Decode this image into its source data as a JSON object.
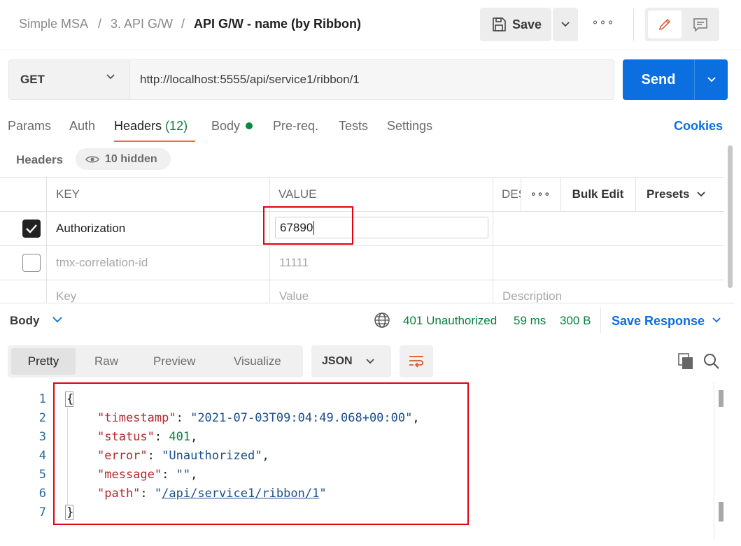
{
  "breadcrumb": {
    "collection": "Simple MSA",
    "folder": "3. API G/W",
    "request": "API G/W - name (by Ribbon)",
    "separator": "/"
  },
  "toolbar": {
    "save_label": "Save",
    "more": "∘∘∘"
  },
  "request": {
    "method": "GET",
    "url": "http://localhost:5555/api/service1/ribbon/1",
    "send_label": "Send"
  },
  "tabs": [
    {
      "label": "Params"
    },
    {
      "label": "Auth"
    },
    {
      "label": "Headers",
      "count": "(12)"
    },
    {
      "label": "Body"
    },
    {
      "label": "Pre-req."
    },
    {
      "label": "Tests"
    },
    {
      "label": "Settings"
    }
  ],
  "cookies_label": "Cookies",
  "headers_section": {
    "title": "Headers",
    "hidden_label": "10 hidden"
  },
  "headers_table": {
    "columns": {
      "key": "KEY",
      "value": "VALUE",
      "description": "DES"
    },
    "more": "∘∘∘",
    "bulk_edit": "Bulk Edit",
    "presets": "Presets",
    "rows": [
      {
        "enabled": true,
        "key": "Authorization",
        "value": "67890"
      },
      {
        "enabled": false,
        "key": "tmx-correlation-id",
        "value": "11111"
      }
    ],
    "placeholder": {
      "key": "Key",
      "value": "Value",
      "description": "Description"
    }
  },
  "response": {
    "body_label": "Body",
    "status": "401 Unauthorized",
    "time": "59 ms",
    "size": "300 B",
    "save_response": "Save Response",
    "view_tabs": [
      "Pretty",
      "Raw",
      "Preview",
      "Visualize"
    ],
    "format": "JSON",
    "line_numbers": [
      "1",
      "2",
      "3",
      "4",
      "5",
      "6",
      "7"
    ],
    "json": {
      "timestamp_key": "\"timestamp\"",
      "timestamp_val": "\"2021-07-03T09:04:49.068+00:00\"",
      "status_key": "\"status\"",
      "status_val": "401",
      "error_key": "\"error\"",
      "error_val": "\"Unauthorized\"",
      "message_key": "\"message\"",
      "message_val": "\"\"",
      "path_key": "\"path\"",
      "path_val": "/api/service1/ribbon/1"
    }
  },
  "colors": {
    "accent_blue": "#0b6fe0",
    "status_green": "#0a7f3c",
    "tab_underline": "#f26b3a",
    "highlight_red": "#e3000f"
  },
  "icons": [
    "save-icon",
    "chevron-down-icon",
    "more-icon",
    "pencil-icon",
    "comment-icon",
    "eye-icon",
    "check-icon",
    "globe-icon",
    "copy-icon",
    "search-icon",
    "wrap-icon"
  ]
}
